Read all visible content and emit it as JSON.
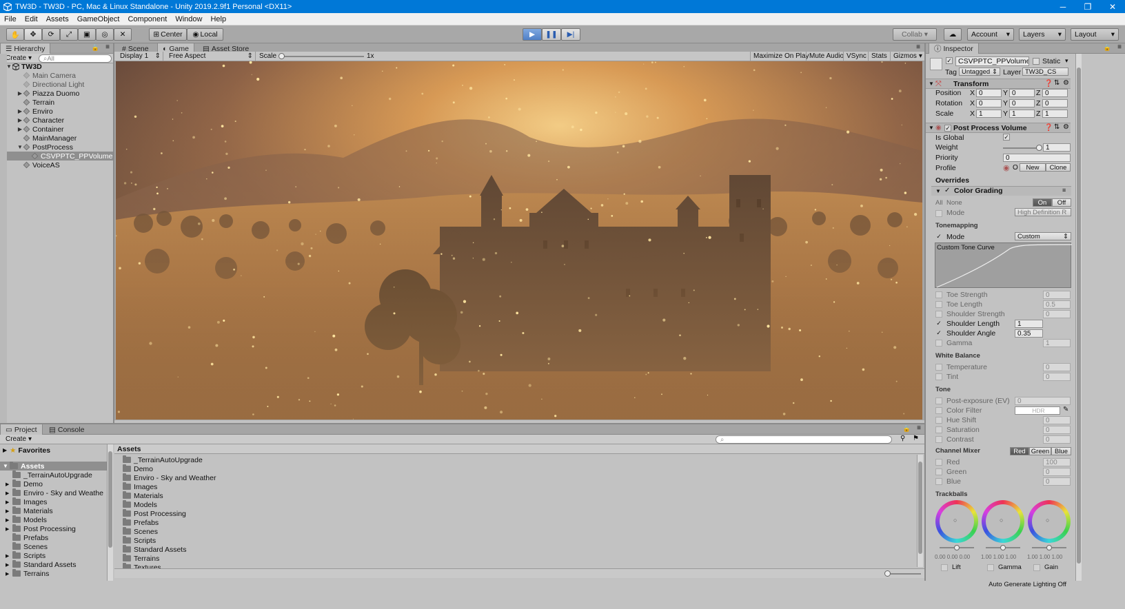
{
  "window": {
    "title": "TW3D - TW3D - PC, Mac & Linux Standalone - Unity 2019.2.9f1 Personal <DX11>",
    "controls": [
      "─",
      "❐",
      "✕"
    ]
  },
  "menu": [
    "File",
    "Edit",
    "Assets",
    "GameObject",
    "Component",
    "Window",
    "Help"
  ],
  "toolbar": {
    "pivot": "Center",
    "space": "Local",
    "collab": "Collab ▾",
    "account": "Account",
    "layers": "Layers",
    "layout": "Layout"
  },
  "hierarchy": {
    "tab": "Hierarchy",
    "create": "Create",
    "search_placeholder": "All",
    "scene": "TW3D",
    "items": [
      {
        "label": "Main Camera",
        "expand": "",
        "disabled": true
      },
      {
        "label": "Directional Light",
        "expand": "",
        "disabled": true
      },
      {
        "label": "Piazza Duomo",
        "expand": "▶",
        "disabled": false
      },
      {
        "label": "Terrain",
        "expand": "",
        "disabled": false
      },
      {
        "label": "Enviro",
        "expand": "▶",
        "disabled": false
      },
      {
        "label": "Character",
        "expand": "▶",
        "disabled": false
      },
      {
        "label": "Container",
        "expand": "▶",
        "disabled": false
      },
      {
        "label": "MainManager",
        "expand": "",
        "disabled": false
      },
      {
        "label": "PostProcess",
        "expand": "▼",
        "disabled": false
      },
      {
        "label": "CSVPPTC_PPVolume",
        "expand": "",
        "disabled": false,
        "selected": true
      },
      {
        "label": "VoiceAS",
        "expand": "",
        "disabled": false
      }
    ]
  },
  "center_tabs": {
    "scene": "Scene",
    "game": "Game",
    "asset_store": "Asset Store"
  },
  "game_bar": {
    "display": "Display 1",
    "aspect": "Free Aspect",
    "scale_label": "Scale",
    "scale_value": "1x",
    "maximize": "Maximize On Play",
    "mute": "Mute Audio",
    "vsync": "VSync",
    "stats": "Stats",
    "gizmos": "Gizmos"
  },
  "inspector": {
    "tab": "Inspector",
    "object_name": "CSVPPTC_PPVolume",
    "static": "Static",
    "tag_label": "Tag",
    "tag": "Untagged",
    "layer_label": "Layer",
    "layer": "TW3D_CS",
    "transform": {
      "title": "Transform",
      "rows": [
        {
          "label": "Position",
          "x": "0",
          "y": "0",
          "z": "0"
        },
        {
          "label": "Rotation",
          "x": "0",
          "y": "0",
          "z": "0"
        },
        {
          "label": "Scale",
          "x": "1",
          "y": "1",
          "z": "1"
        }
      ],
      "axis": [
        "X",
        "Y",
        "Z"
      ]
    },
    "ppv": {
      "title": "Post Process Volume",
      "is_global": "Is Global",
      "weight_label": "Weight",
      "weight": "1",
      "weight_fraction": 1,
      "priority_label": "Priority",
      "priority": "0",
      "profile_label": "Profile",
      "profile_value": "O",
      "new_btn": "New",
      "clone_btn": "Clone"
    },
    "overrides": "Overrides",
    "color_grading": {
      "title": "Color Grading",
      "all": "All",
      "none": "None",
      "on": "On",
      "off": "Off",
      "mode_label": "Mode",
      "mode_value": "High Definition R",
      "tonemapping": "Tonemapping",
      "tm_mode_label": "Mode",
      "tm_mode_value": "Custom",
      "curve_label": "Custom Tone Curve",
      "curve_params": [
        {
          "label": "Toe Strength",
          "value": "0",
          "on": false
        },
        {
          "label": "Toe Length",
          "value": "0.5",
          "on": false
        },
        {
          "label": "Shoulder Strength",
          "value": "0",
          "on": false
        },
        {
          "label": "Shoulder Length",
          "value": "1",
          "on": true
        },
        {
          "label": "Shoulder Angle",
          "value": "0.35",
          "on": true
        },
        {
          "label": "Gamma",
          "value": "1",
          "on": false
        }
      ],
      "white_balance": "White Balance",
      "wb_params": [
        {
          "label": "Temperature",
          "value": "0"
        },
        {
          "label": "Tint",
          "value": "0"
        }
      ],
      "tone": "Tone",
      "tone_params": [
        {
          "label": "Post-exposure (EV)",
          "value": "0"
        },
        {
          "label": "Color Filter",
          "value": "HDR"
        },
        {
          "label": "Hue Shift",
          "value": "0"
        },
        {
          "label": "Saturation",
          "value": "0"
        },
        {
          "label": "Contrast",
          "value": "0"
        }
      ],
      "channel_mixer": "Channel Mixer",
      "channels": [
        "Red",
        "Green",
        "Blue"
      ],
      "mixer_params": [
        {
          "label": "Red",
          "value": "100"
        },
        {
          "label": "Green",
          "value": "0"
        },
        {
          "label": "Blue",
          "value": "0"
        }
      ],
      "trackballs": "Trackballs",
      "trackball_values": [
        "0.00 0.00 0.00",
        "1.00 1.00 1.00",
        "1.00 1.00 1.00"
      ],
      "trackball_labels": [
        "Lift",
        "Gamma",
        "Gain"
      ]
    }
  },
  "project": {
    "tab_project": "Project",
    "tab_console": "Console",
    "create": "Create",
    "count": "10",
    "favorites": "Favorites",
    "assets_root": "Assets",
    "tree": [
      {
        "label": "_TerrainAutoUpgrade",
        "expand": ""
      },
      {
        "label": "Demo",
        "expand": "▶"
      },
      {
        "label": "Enviro - Sky and Weathe",
        "expand": "▶"
      },
      {
        "label": "Images",
        "expand": "▶"
      },
      {
        "label": "Materials",
        "expand": "▶"
      },
      {
        "label": "Models",
        "expand": "▶"
      },
      {
        "label": "Post Processing",
        "expand": "▶"
      },
      {
        "label": "Prefabs",
        "expand": ""
      },
      {
        "label": "Scenes",
        "expand": ""
      },
      {
        "label": "Scripts",
        "expand": "▶"
      },
      {
        "label": "Standard Assets",
        "expand": "▶"
      },
      {
        "label": "Terrains",
        "expand": "▶"
      }
    ],
    "breadcrumb": "Assets",
    "list": [
      "_TerrainAutoUpgrade",
      "Demo",
      "Enviro - Sky and Weather",
      "Images",
      "Materials",
      "Models",
      "Post Processing",
      "Prefabs",
      "Scenes",
      "Scripts",
      "Standard Assets",
      "Terrains",
      "Textures"
    ]
  },
  "status": {
    "right": "Auto Generate Lighting Off"
  }
}
